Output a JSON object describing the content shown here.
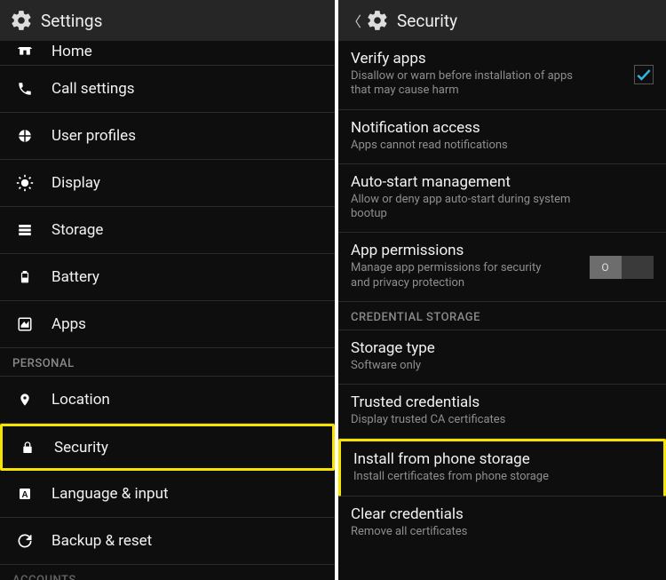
{
  "left": {
    "header": "Settings",
    "items": [
      {
        "icon": "home",
        "label": "Home"
      },
      {
        "icon": "phone",
        "label": "Call settings"
      },
      {
        "icon": "profiles",
        "label": "User profiles"
      },
      {
        "icon": "display",
        "label": "Display"
      },
      {
        "icon": "storage",
        "label": "Storage"
      },
      {
        "icon": "battery",
        "label": "Battery"
      },
      {
        "icon": "apps",
        "label": "Apps"
      }
    ],
    "personal_header": "PERSONAL",
    "personal": [
      {
        "icon": "location",
        "label": "Location"
      },
      {
        "icon": "lock",
        "label": "Security",
        "highlight": true
      },
      {
        "icon": "language",
        "label": "Language & input"
      },
      {
        "icon": "backup",
        "label": "Backup & reset"
      }
    ],
    "accounts_header": "ACCOUNTS"
  },
  "right": {
    "header": "Security",
    "rows": [
      {
        "title": "Verify apps",
        "sub": "Disallow or warn before installation of apps that may cause harm",
        "checked": true
      },
      {
        "title": "Notification access",
        "sub": "Apps cannot read notifications"
      },
      {
        "title": "Auto-start management",
        "sub": "Allow or deny app auto-start during system bootup"
      },
      {
        "title": "App permissions",
        "sub": "Manage app permissions for security and privacy protection",
        "toggle": "off"
      }
    ],
    "cred_header": "CREDENTIAL STORAGE",
    "cred": [
      {
        "title": "Storage type",
        "sub": "Software only"
      },
      {
        "title": "Trusted credentials",
        "sub": "Display trusted CA certificates"
      },
      {
        "title": "Install from phone storage",
        "sub": "Install certificates from phone storage",
        "highlight": true
      },
      {
        "title": "Clear credentials",
        "sub": "Remove all certificates"
      }
    ],
    "toggle_off_label": "O"
  }
}
